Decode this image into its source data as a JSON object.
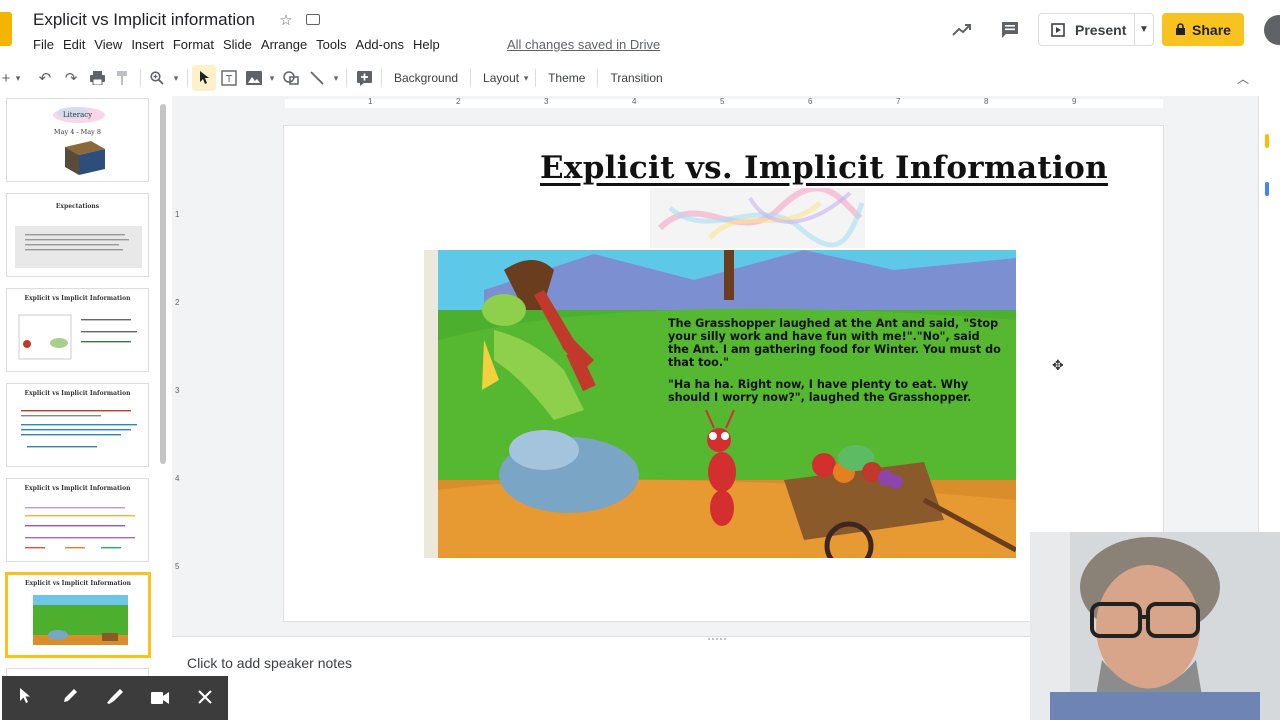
{
  "app": {
    "doc_title": "Explicit vs Implicit information",
    "save_status": "All changes saved in Drive",
    "menus": [
      "File",
      "Edit",
      "View",
      "Insert",
      "Format",
      "Slide",
      "Arrange",
      "Tools",
      "Add-ons",
      "Help"
    ],
    "present_label": "Present",
    "share_label": "Share"
  },
  "toolbar": {
    "background_label": "Background",
    "layout_label": "Layout",
    "theme_label": "Theme",
    "transition_label": "Transition"
  },
  "ruler": {
    "top_marks": [
      "1",
      "2",
      "3",
      "4",
      "5",
      "6",
      "7",
      "8",
      "9"
    ],
    "left_marks": [
      "1",
      "2",
      "3",
      "4",
      "5"
    ]
  },
  "filmstrip": {
    "slides": [
      {
        "title": "Literacy",
        "subtitle": "May 4 - May 8"
      },
      {
        "title": "Expectations",
        "subtitle": ""
      },
      {
        "title": "Explicit vs Implicit Information",
        "subtitle": ""
      },
      {
        "title": "Explicit vs Implicit Information",
        "subtitle": ""
      },
      {
        "title": "Explicit vs Implicit Information",
        "subtitle": ""
      },
      {
        "title": "Explicit vs Implicit Information",
        "subtitle": ""
      }
    ],
    "selected_index": 5
  },
  "slide": {
    "title": "Explicit vs. Implicit Information",
    "story_paragraph_1": "The Grasshopper laughed at the Ant and said, \"Stop your silly work and have fun with me!\".\"No\", said the Ant. I am gathering food for Winter. You must do that too.\"",
    "story_paragraph_2": "\"Ha ha ha. Right now, I have plenty to eat. Why should I worry now?\", laughed the Grasshopper."
  },
  "notes": {
    "placeholder": "Click to add speaker notes"
  },
  "colors": {
    "share": "#f9c31f",
    "selected_thumb": "#f9c31f",
    "grass": "#4caf2e",
    "sky": "#5ec8e8"
  }
}
